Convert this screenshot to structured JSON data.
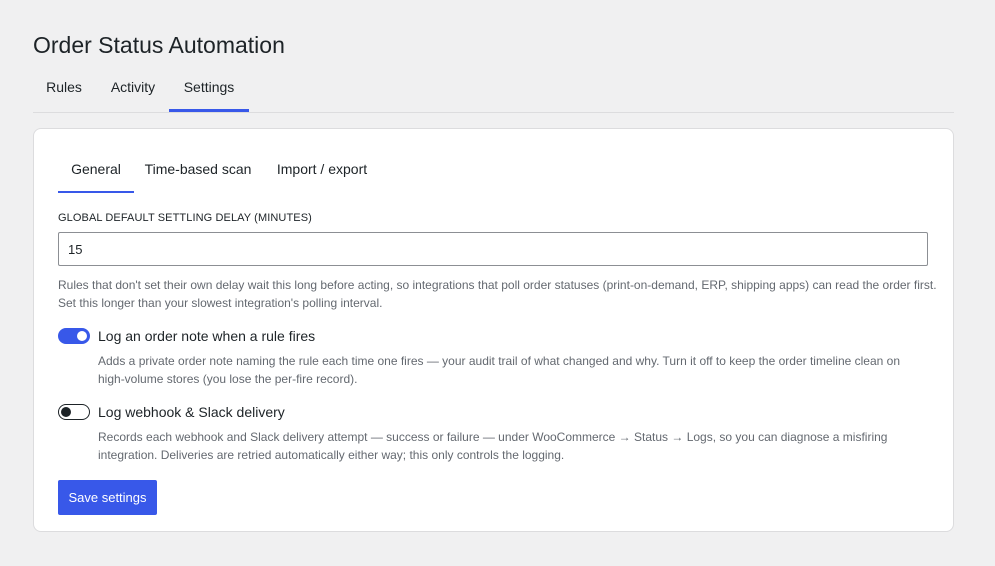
{
  "page": {
    "title": "Order Status Automation"
  },
  "main_tabs": [
    {
      "label": "Rules",
      "active": false
    },
    {
      "label": "Activity",
      "active": false
    },
    {
      "label": "Settings",
      "active": true
    }
  ],
  "sub_tabs": [
    {
      "label": "General",
      "active": true
    },
    {
      "label": "Time-based scan",
      "active": false
    },
    {
      "label": "Import / export",
      "active": false
    }
  ],
  "settings": {
    "delay": {
      "label": "GLOBAL DEFAULT SETTLING DELAY (MINUTES)",
      "value": "15",
      "help": "Rules that don't set their own delay wait this long before acting, so integrations that poll order statuses (print-on-demand, ERP, shipping apps) can read the order first. Set this longer than your slowest integration's polling interval."
    },
    "order_note": {
      "label": "Log an order note when a rule fires",
      "enabled": true,
      "help": "Adds a private order note naming the rule each time one fires — your audit trail of what changed and why. Turn it off to keep the order timeline clean on high-volume stores (you lose the per-fire record)."
    },
    "webhook_log": {
      "label": "Log webhook & Slack delivery",
      "enabled": false,
      "help": "Records each webhook and Slack delivery attempt — success or failure — under WooCommerce → Status → Logs, so you can diagnose a misfiring integration. Deliveries are retried automatically either way; this only controls the logging."
    }
  },
  "actions": {
    "save_label": "Save settings"
  },
  "colors": {
    "accent": "#3858e9",
    "background": "#f0f0f1",
    "card": "#ffffff",
    "text": "#1d2327",
    "muted": "#646970"
  }
}
